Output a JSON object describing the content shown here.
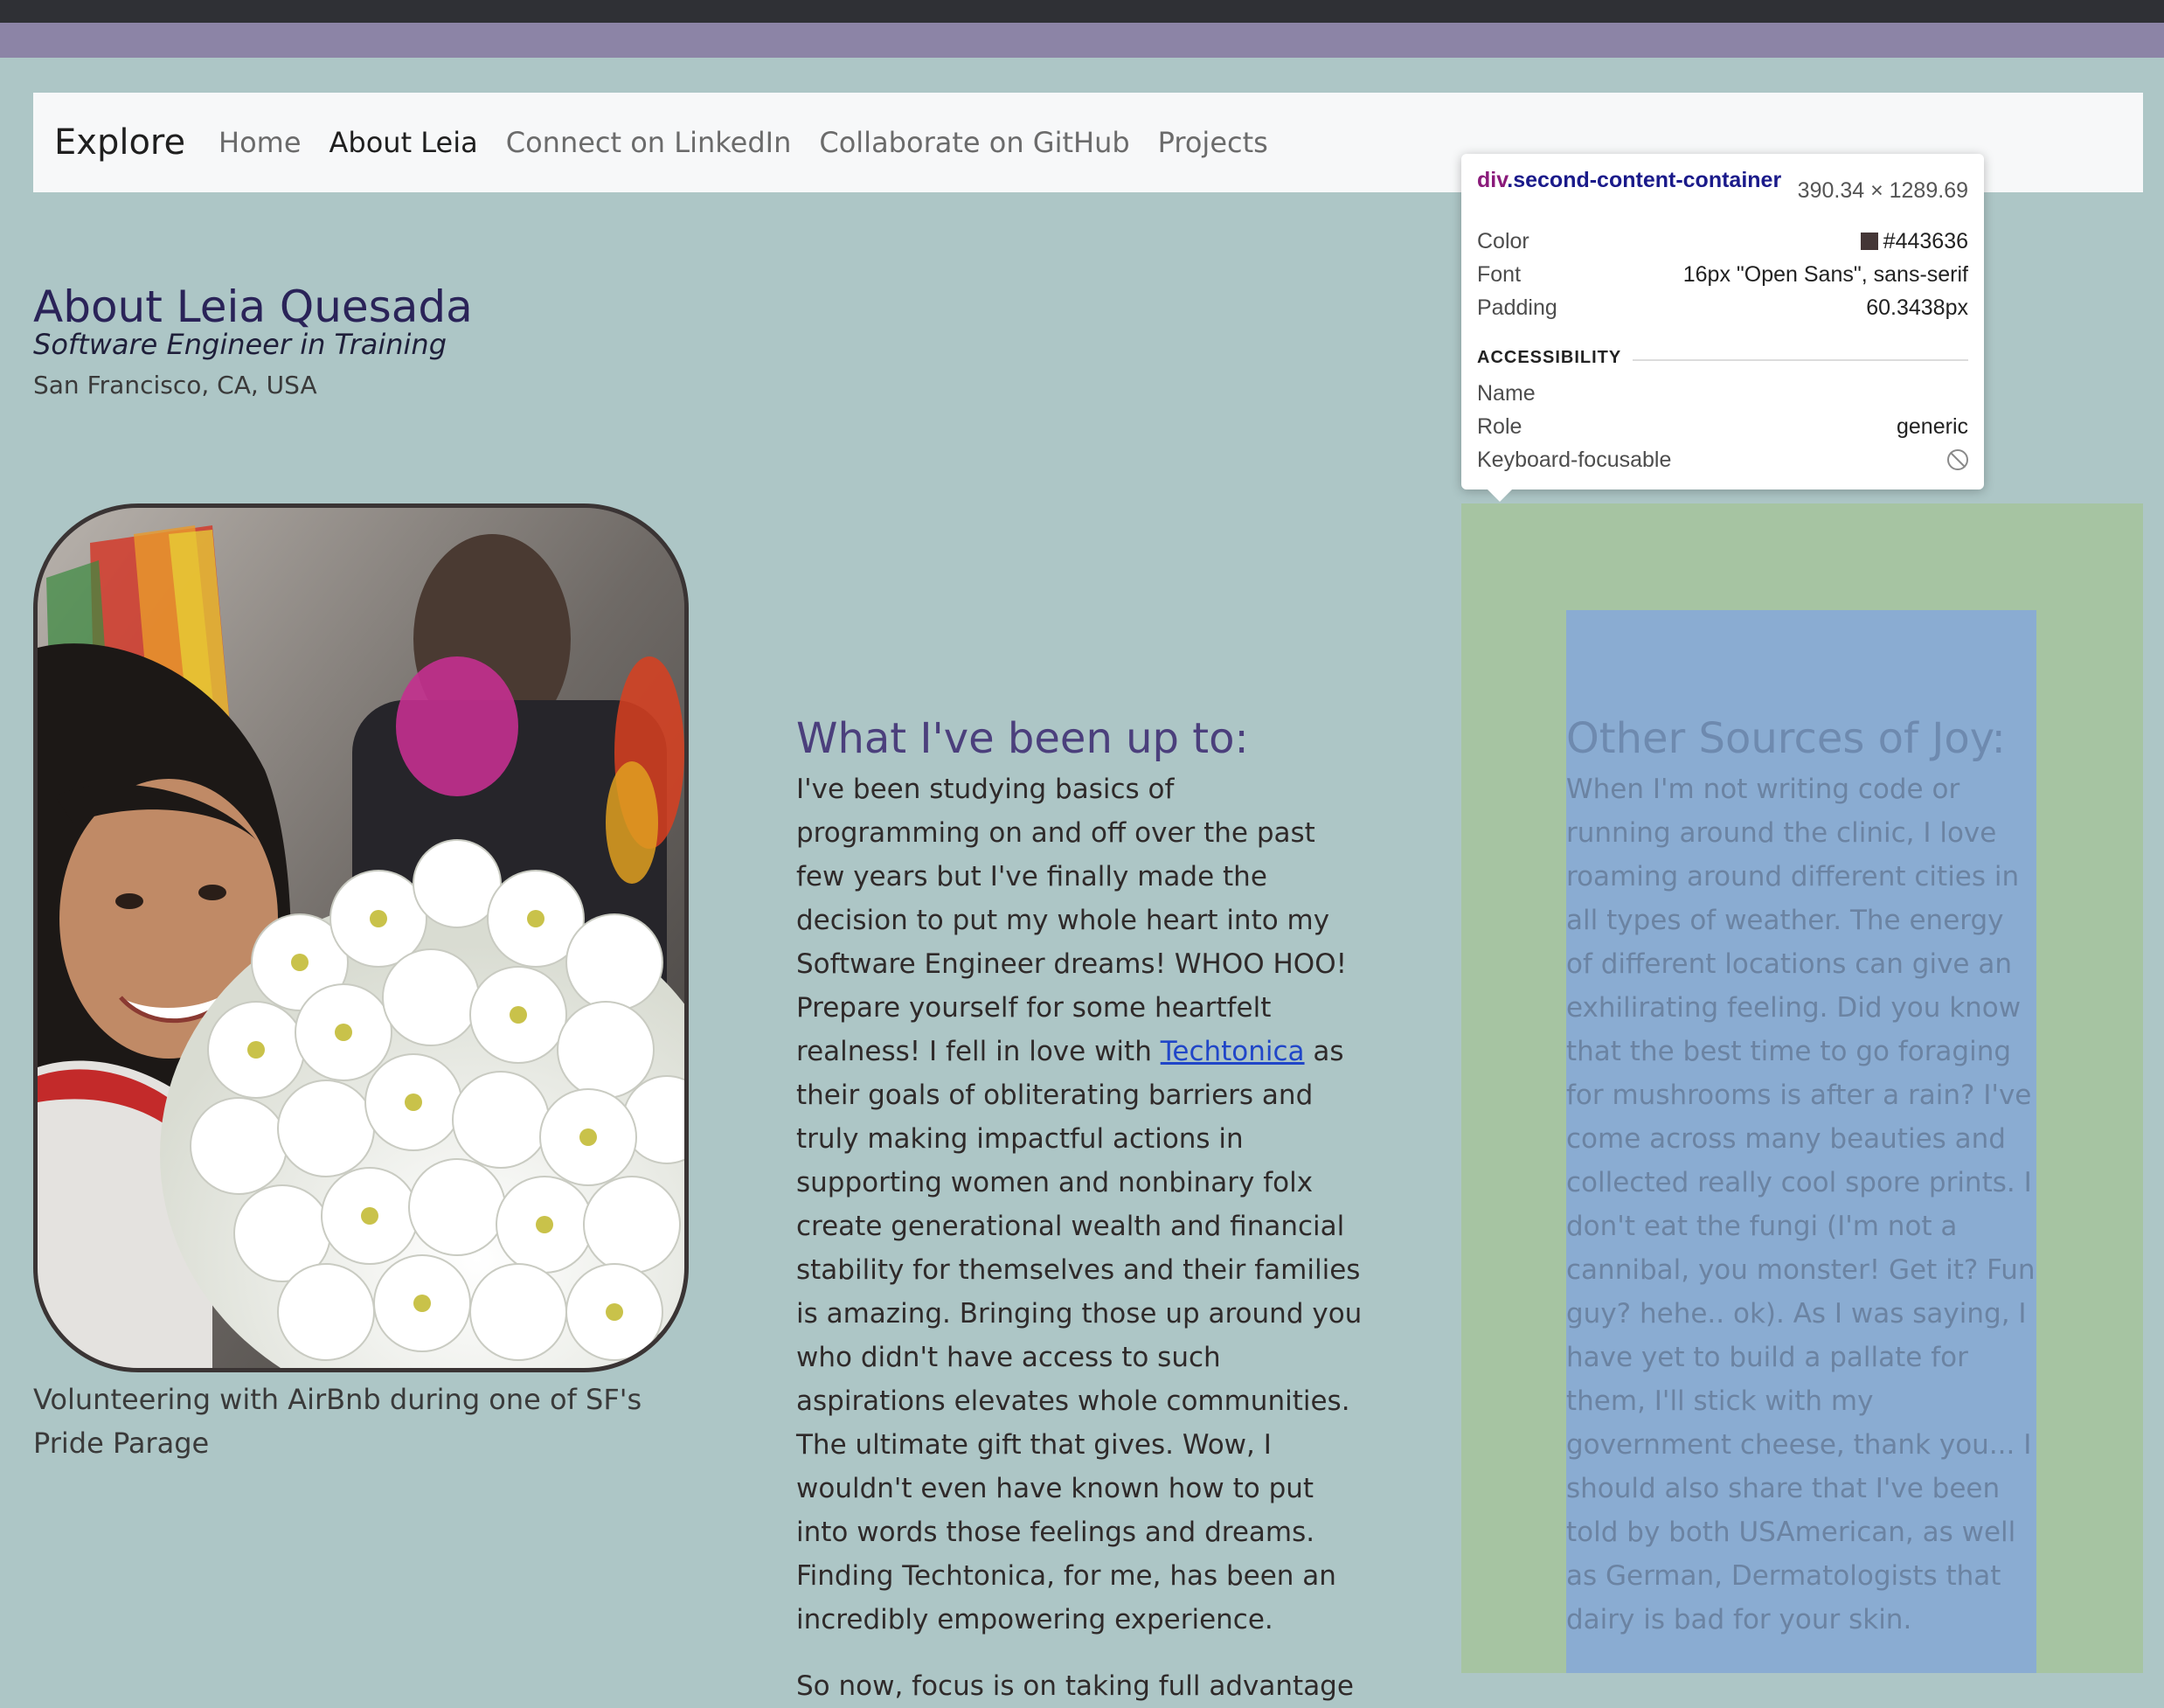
{
  "navbar": {
    "brand": "Explore",
    "links": [
      "Home",
      "About Leia",
      "Connect on LinkedIn",
      "Collaborate on GitHub",
      "Projects"
    ],
    "active": "About Leia"
  },
  "header": {
    "title": "About Leia Quesada",
    "subtitle": "Software Engineer in Training",
    "location": "San Francisco, CA, USA"
  },
  "photo": {
    "caption": "Volunteering with AirBnb during one of SF's Pride Parage"
  },
  "column2": {
    "heading": "What I've been up to:",
    "paragraph1_before_link": "I've been studying basics of programming on and off over the past few years but I've finally made the decision to put my whole heart into my Software Engineer dreams! WHOO HOO! Prepare yourself for some heartfelt realness! I fell in love with ",
    "link_text": "Techtonica",
    "paragraph1_after_link": " as their goals of obliterating barriers and truly making impactful actions in supporting women and nonbinary folx create generational wealth and financial stability for themselves and their families is amazing. Bringing those up around you who didn't have access to such aspirations elevates whole communities. The ultimate gift that gives. Wow, I wouldn't even have known how to put into words those feelings and dreams. Finding Techtonica, for me, has been an incredibly empowering experience.",
    "paragraph2": "So now, focus is on taking full advantage"
  },
  "column3": {
    "heading": "Other Sources of Joy:",
    "paragraph": "When I'm not writing code or running around the clinic, I love roaming around different cities in all types of weather. The energy of different locations can give an exhilirating feeling. Did you know that the best time to go foraging for mushrooms is after a rain? I've come across many beauties and collected really cool spore prints. I don't eat the fungi (I'm not a cannibal, you monster! Get it? Fun guy? hehe.. ok). As I was saying, I have yet to build a pallate for them, I'll stick with my government cheese, thank you... I should also share that I've been told by both USAmerican, as well as German, Dermatologists that dairy is bad for your skin."
  },
  "inspector": {
    "tag": "div",
    "class_name": ".second-content-container",
    "dimensions": "390.34 × 1289.69",
    "rows": {
      "color_label": "Color",
      "color_value": "#443636",
      "font_label": "Font",
      "font_value": "16px \"Open Sans\", sans-serif",
      "padding_label": "Padding",
      "padding_value": "60.3438px"
    },
    "accessibility": {
      "section_label": "ACCESSIBILITY",
      "name_label": "Name",
      "role_label": "Role",
      "role_value": "generic",
      "focusable_label": "Keyboard-focusable"
    }
  },
  "colors": {
    "page_bg": "#adc6c6",
    "accent_title": "#2a2358",
    "container_green": "#a6c4a2",
    "content_blue": "#8aacd2"
  }
}
